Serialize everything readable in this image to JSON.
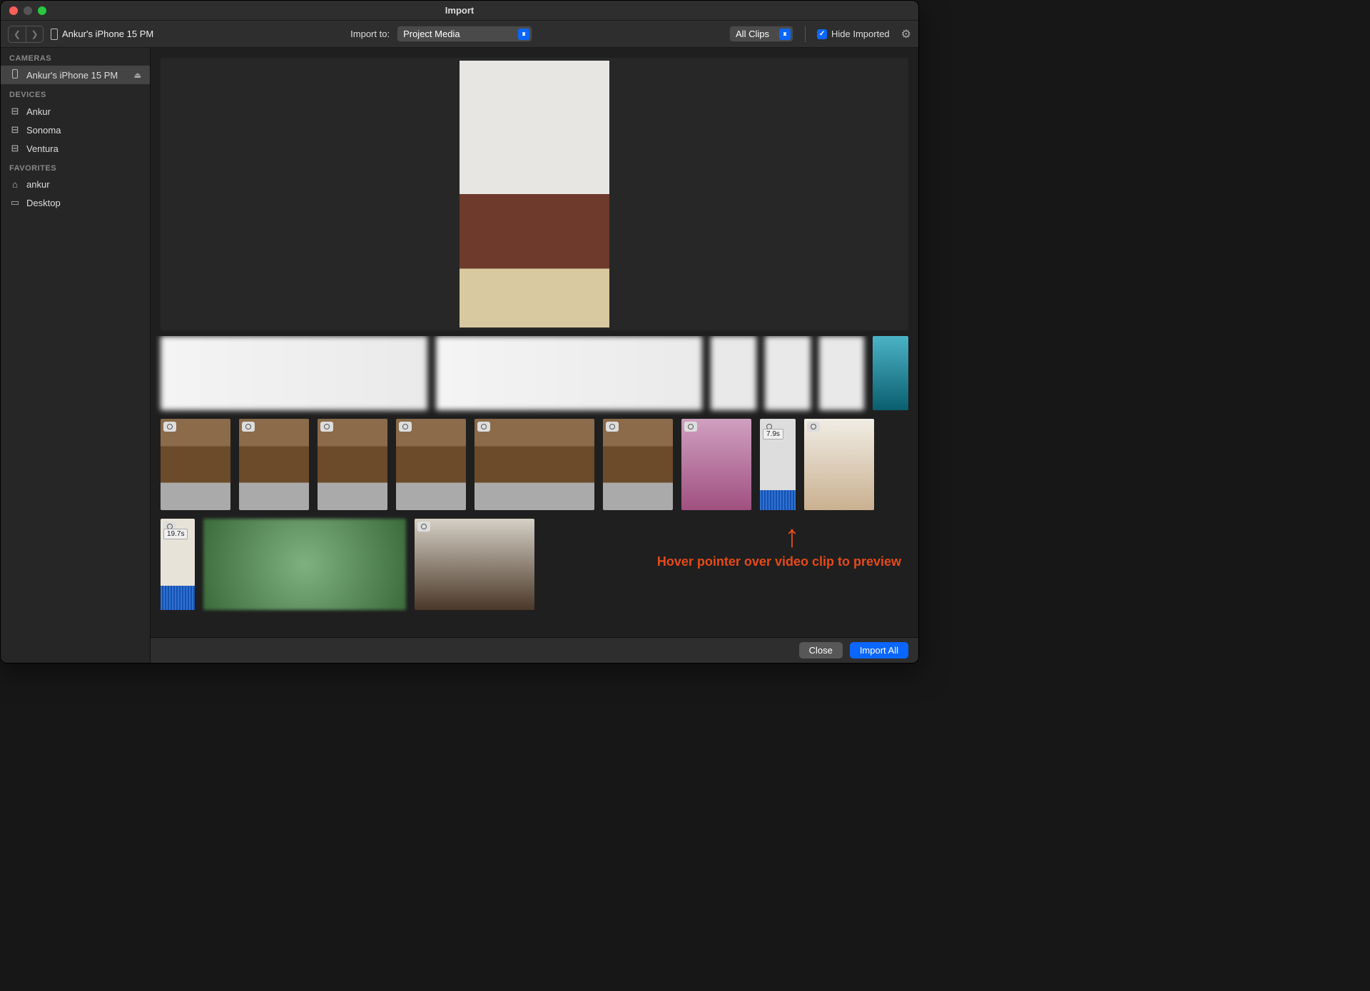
{
  "window": {
    "title": "Import"
  },
  "toolbar": {
    "device": "Ankur's iPhone 15 PM",
    "import_to_label": "Import to:",
    "import_to_value": "Project Media",
    "filter_value": "All Clips",
    "hide_imported_label": "Hide Imported",
    "hide_imported_checked": true
  },
  "sidebar": {
    "sections": [
      {
        "heading": "CAMERAS",
        "items": [
          {
            "icon": "phone",
            "label": "Ankur's iPhone 15 PM",
            "eject": true,
            "selected": true
          }
        ]
      },
      {
        "heading": "DEVICES",
        "items": [
          {
            "icon": "disk",
            "label": "Ankur"
          },
          {
            "icon": "disk",
            "label": "Sonoma"
          },
          {
            "icon": "disk",
            "label": "Ventura"
          }
        ]
      },
      {
        "heading": "FAVORITES",
        "items": [
          {
            "icon": "home",
            "label": "ankur"
          },
          {
            "icon": "desktop",
            "label": "Desktop"
          }
        ]
      }
    ]
  },
  "grid": {
    "row2_durations": [
      "7.9s"
    ],
    "row3_durations": [
      "19.7s"
    ]
  },
  "annotation": {
    "text": "Hover pointer over video clip to preview"
  },
  "footer": {
    "close": "Close",
    "import_all": "Import All"
  }
}
